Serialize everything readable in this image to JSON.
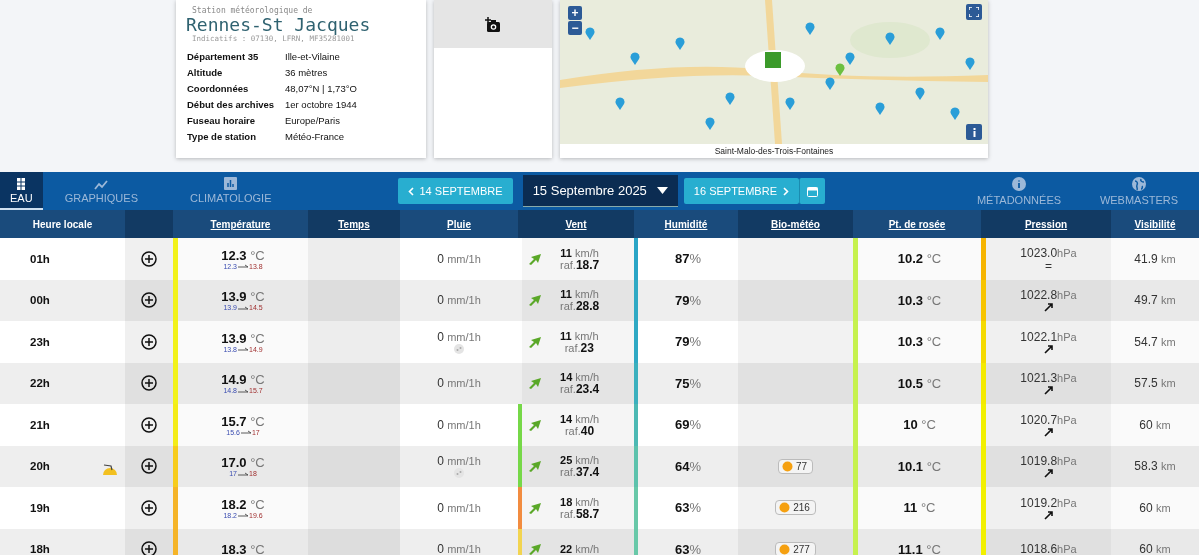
{
  "station": {
    "caption": "Station météorologique de",
    "name": "Rennes-St Jacques",
    "codes": "Indicatifs : 07130, LFRN, MF35281001",
    "facts": [
      {
        "label": "Département 35",
        "value": "Ille-et-Vilaine"
      },
      {
        "label": "Altitude",
        "value": "36 mètres"
      },
      {
        "label": "Coordonnées",
        "value": "48,07°N | 1,73°O"
      },
      {
        "label": "Début des archives",
        "value": "1er octobre 1944"
      },
      {
        "label": "Fuseau horaire",
        "value": "Europe/Paris"
      },
      {
        "label": "Type de station",
        "value": "Météo-France"
      }
    ]
  },
  "map": {
    "zoom_in": "+",
    "zoom_out": "−",
    "caption": "Saint-Malo-des-Trois-Fontaines"
  },
  "tabs": [
    {
      "label": "EAU",
      "kind": "table",
      "selected": true
    },
    {
      "label": "GRAPHIQUES",
      "kind": "graph",
      "selected": false
    },
    {
      "label": "CLIMATOLOGIE",
      "kind": "climate",
      "selected": false
    }
  ],
  "date_nav": {
    "previous": "14 SEPTEMBRE",
    "current": "15 Septembre 2025",
    "next": "16 SEPTEMBRE"
  },
  "right_links": [
    {
      "label": "MÉTADONNÉES",
      "kind": "info"
    },
    {
      "label": "WEBMASTERS",
      "kind": "globe"
    }
  ],
  "columns": [
    {
      "kind": "label",
      "label": "Heure locale",
      "link": false
    },
    {
      "kind": "blank"
    },
    {
      "label": "Température",
      "link": true
    },
    {
      "label": "Temps",
      "link": true
    },
    {
      "label": "Pluie",
      "link": true
    },
    {
      "label": "Vent",
      "link": true
    },
    {
      "label": "Humidité",
      "link": true
    },
    {
      "label": "Bio-météo",
      "link": true
    },
    {
      "label": "Pt. de rosée",
      "link": true
    },
    {
      "label": "Pression",
      "link": true
    },
    {
      "label": "Visibilité",
      "link": true
    }
  ],
  "rows": [
    {
      "hour": "01h",
      "sunset": false,
      "temp": {
        "value": "12.3",
        "unit": "°C",
        "min": "12.3",
        "max": "13.8",
        "color": "#f2f21a"
      },
      "rain": {
        "value": "0",
        "unit": "mm/1h",
        "icon": false
      },
      "wind": {
        "value": "11",
        "unit": "km/h",
        "gust_label": "raf.",
        "gust": "18.7"
      },
      "humidity": {
        "value": "87",
        "unit": "%",
        "color": "#2aa5c6"
      },
      "dew": {
        "value": "10.2",
        "unit": "°C",
        "color": "#c6f24e"
      },
      "pressure": {
        "value": "1023.0",
        "unit": "hPa",
        "trend": {
          "kind": "symbol",
          "text": "="
        },
        "color": "#f6b400"
      },
      "visibility": {
        "value": "41.9",
        "unit": "km"
      }
    },
    {
      "hour": "00h",
      "sunset": false,
      "temp": {
        "value": "13.9",
        "unit": "°C",
        "min": "13.9",
        "max": "14.5",
        "color": "#f2f21a"
      },
      "rain": {
        "value": "0",
        "unit": "mm/1h",
        "icon": false
      },
      "wind": {
        "value": "11",
        "unit": "km/h",
        "gust_label": "raf.",
        "gust": "28.8"
      },
      "humidity": {
        "value": "79",
        "unit": "%",
        "color": "#2fa9c4"
      },
      "dew": {
        "value": "10.3",
        "unit": "°C",
        "color": "#c6f24e"
      },
      "pressure": {
        "value": "1022.8",
        "unit": "hPa",
        "trend": {
          "kind": "arrow"
        },
        "color": "#f7c400"
      },
      "visibility": {
        "value": "49.7",
        "unit": "km"
      }
    },
    {
      "hour": "23h",
      "sunset": false,
      "temp": {
        "value": "13.9",
        "unit": "°C",
        "min": "13.8",
        "max": "14.9",
        "color": "#f2f21a"
      },
      "rain": {
        "value": "0",
        "unit": "mm/1h",
        "icon": true
      },
      "wind": {
        "value": "11",
        "unit": "km/h",
        "gust_label": "raf.",
        "gust": "23"
      },
      "humidity": {
        "value": "79",
        "unit": "%",
        "color": "#2fa9c4"
      },
      "dew": {
        "value": "10.3",
        "unit": "°C",
        "color": "#c6f24e"
      },
      "pressure": {
        "value": "1022.1",
        "unit": "hPa",
        "trend": {
          "kind": "arrow"
        },
        "color": "#f5da00"
      },
      "visibility": {
        "value": "54.7",
        "unit": "km"
      }
    },
    {
      "hour": "22h",
      "sunset": false,
      "temp": {
        "value": "14.9",
        "unit": "°C",
        "min": "14.8",
        "max": "15.7",
        "color": "#f2f21a"
      },
      "rain": {
        "value": "0",
        "unit": "mm/1h",
        "icon": false
      },
      "wind": {
        "value": "14",
        "unit": "km/h",
        "gust_label": "raf.",
        "gust": "23.4"
      },
      "humidity": {
        "value": "75",
        "unit": "%",
        "color": "#3bb0be"
      },
      "dew": {
        "value": "10.5",
        "unit": "°C",
        "color": "#c6f24e"
      },
      "pressure": {
        "value": "1021.3",
        "unit": "hPa",
        "trend": {
          "kind": "arrow"
        },
        "color": "#f4ea00"
      },
      "visibility": {
        "value": "57.5",
        "unit": "km"
      }
    },
    {
      "hour": "21h",
      "sunset": false,
      "temp": {
        "value": "15.7",
        "unit": "°C",
        "min": "15.6",
        "max": "17",
        "color": "#f4ec18"
      },
      "rain": {
        "value": "0",
        "unit": "mm/1h",
        "icon": false
      },
      "wind": {
        "value": "14",
        "unit": "km/h",
        "gust_label": "raf.",
        "gust": "40",
        "color": "#76d848"
      },
      "humidity": {
        "value": "69",
        "unit": "%",
        "color": "#4cb9b4"
      },
      "dew": {
        "value": "10",
        "unit": "°C",
        "color": "#c6f24e"
      },
      "pressure": {
        "value": "1020.7",
        "unit": "hPa",
        "trend": {
          "kind": "arrow"
        },
        "color": "#f2f000"
      },
      "visibility": {
        "value": "60",
        "unit": "km"
      }
    },
    {
      "hour": "20h",
      "sunset": true,
      "temp": {
        "value": "17.0",
        "unit": "°C",
        "min": "17",
        "max": "18",
        "color": "#f7cc1c"
      },
      "rain": {
        "value": "0",
        "unit": "mm/1h",
        "icon": true
      },
      "wind": {
        "value": "25",
        "unit": "km/h",
        "gust_label": "raf.",
        "gust": "37.4",
        "color": "#76d848"
      },
      "humidity": {
        "value": "64",
        "unit": "%",
        "color": "#5cc2ac"
      },
      "bio": {
        "value": "77"
      },
      "dew": {
        "value": "10.1",
        "unit": "°C",
        "color": "#c6f24e"
      },
      "pressure": {
        "value": "1019.8",
        "unit": "hPa",
        "trend": {
          "kind": "arrow"
        },
        "color": "#f2f000"
      },
      "visibility": {
        "value": "58.3",
        "unit": "km"
      }
    },
    {
      "hour": "19h",
      "sunset": false,
      "temp": {
        "value": "18.2",
        "unit": "°C",
        "min": "18.2",
        "max": "19.6",
        "color": "#f5b428"
      },
      "rain": {
        "value": "0",
        "unit": "mm/1h",
        "icon": false
      },
      "wind": {
        "value": "18",
        "unit": "km/h",
        "gust_label": "raf.",
        "gust": "58.7",
        "color": "#f28c40"
      },
      "humidity": {
        "value": "63",
        "unit": "%",
        "color": "#68c8a8"
      },
      "bio": {
        "value": "216"
      },
      "dew": {
        "value": "11",
        "unit": "°C",
        "color": "#c6f24e"
      },
      "pressure": {
        "value": "1019.2",
        "unit": "hPa",
        "trend": {
          "kind": "arrow"
        },
        "color": "#f2f000"
      },
      "visibility": {
        "value": "60",
        "unit": "km"
      }
    },
    {
      "hour": "18h",
      "sunset": false,
      "temp": {
        "value": "18.3",
        "unit": "°C",
        "color": "#f5b428"
      },
      "rain": {
        "value": "0",
        "unit": "mm/1h",
        "icon": false
      },
      "wind": {
        "value": "22",
        "unit": "km/h",
        "color": "#f2d450"
      },
      "humidity": {
        "value": "63",
        "unit": "%",
        "color": "#68c8a8"
      },
      "bio": {
        "value": "277"
      },
      "dew": {
        "value": "11.1",
        "unit": "°C",
        "color": "#c6f24e"
      },
      "pressure": {
        "value": "1018.6",
        "unit": "hPa",
        "color": "#f2f000"
      },
      "visibility": {
        "value": "60",
        "unit": "km"
      }
    }
  ]
}
